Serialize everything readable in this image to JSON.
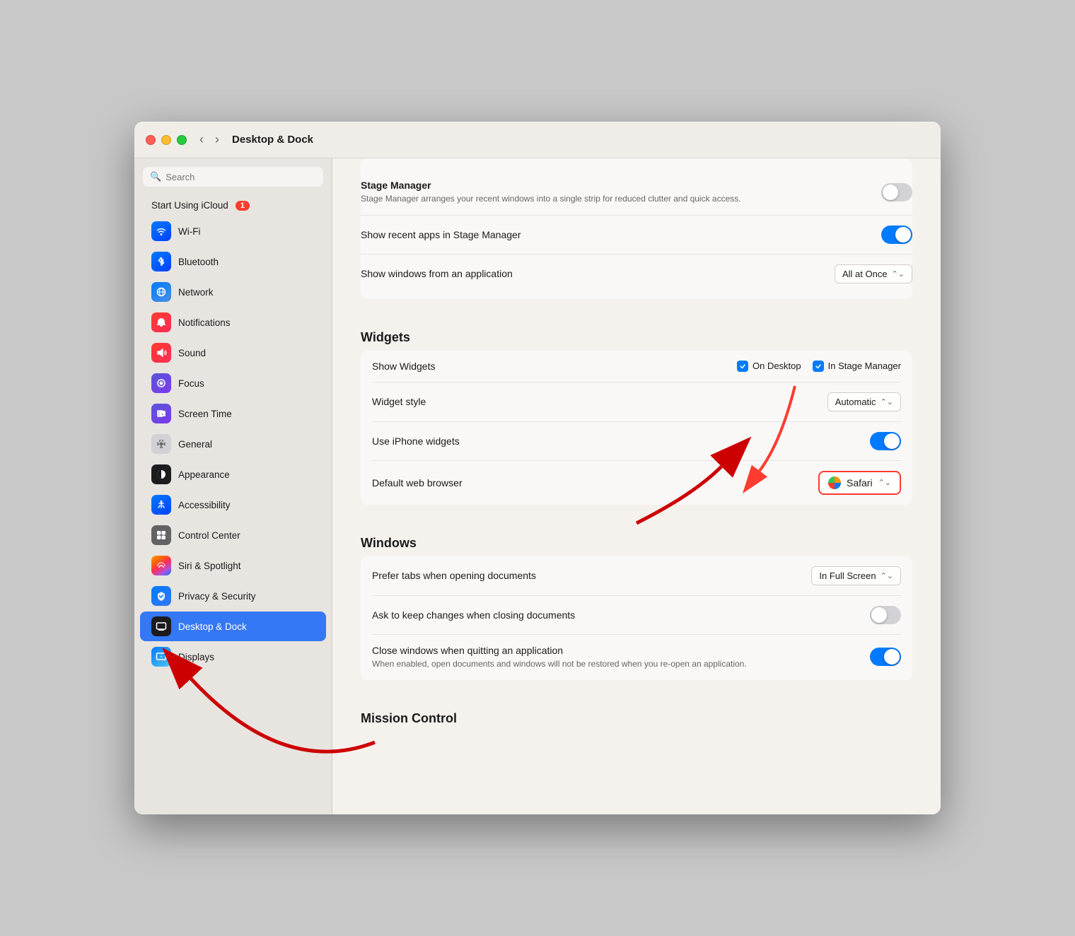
{
  "window": {
    "title": "Desktop & Dock"
  },
  "titlebar": {
    "back_label": "‹",
    "forward_label": "›",
    "title": "Desktop & Dock"
  },
  "sidebar": {
    "search_placeholder": "Search",
    "icloud_label": "Start Using iCloud",
    "icloud_badge": "1",
    "items": [
      {
        "id": "wifi",
        "label": "Wi-Fi",
        "icon_class": "ic-wifi",
        "icon_char": "📶"
      },
      {
        "id": "bluetooth",
        "label": "Bluetooth",
        "icon_class": "ic-bluetooth",
        "icon_char": "B"
      },
      {
        "id": "network",
        "label": "Network",
        "icon_class": "ic-network",
        "icon_char": "🌐"
      },
      {
        "id": "notifications",
        "label": "Notifications",
        "icon_class": "ic-notifications",
        "icon_char": "🔔"
      },
      {
        "id": "sound",
        "label": "Sound",
        "icon_class": "ic-sound",
        "icon_char": "🔊"
      },
      {
        "id": "focus",
        "label": "Focus",
        "icon_class": "ic-focus",
        "icon_char": "🌙"
      },
      {
        "id": "screentime",
        "label": "Screen Time",
        "icon_class": "ic-screentime",
        "icon_char": "⏳"
      },
      {
        "id": "general",
        "label": "General",
        "icon_class": "ic-general",
        "icon_char": "⚙"
      },
      {
        "id": "appearance",
        "label": "Appearance",
        "icon_class": "ic-appearance",
        "icon_char": "◑"
      },
      {
        "id": "accessibility",
        "label": "Accessibility",
        "icon_class": "ic-accessibility",
        "icon_char": "♿"
      },
      {
        "id": "controlcenter",
        "label": "Control Center",
        "icon_class": "ic-controlcenter",
        "icon_char": "⊞"
      },
      {
        "id": "siri",
        "label": "Siri & Spotlight",
        "icon_class": "ic-siri",
        "icon_char": "S"
      },
      {
        "id": "privacy",
        "label": "Privacy & Security",
        "icon_class": "ic-privacy",
        "icon_char": "🔒"
      },
      {
        "id": "desktop",
        "label": "Desktop & Dock",
        "icon_class": "ic-desktop",
        "icon_char": "🖥"
      },
      {
        "id": "displays",
        "label": "Displays",
        "icon_class": "ic-displays",
        "icon_char": "🖵"
      }
    ]
  },
  "main": {
    "stage_manager": {
      "title": "Stage Manager",
      "subtitle": "Stage Manager arranges your recent windows into a single strip for reduced clutter and quick access.",
      "show_recent_apps_label": "Show recent apps in Stage Manager",
      "show_recent_apps_value": true,
      "show_windows_label": "Show windows from an application",
      "show_windows_value": "All at Once"
    },
    "widgets": {
      "section_title": "Widgets",
      "show_widgets_label": "Show Widgets",
      "on_desktop_label": "On Desktop",
      "in_stage_manager_label": "In Stage Manager",
      "on_desktop_checked": true,
      "in_stage_manager_checked": true,
      "widget_style_label": "Widget style",
      "widget_style_value": "Automatic",
      "use_iphone_label": "Use iPhone widgets",
      "use_iphone_value": true,
      "default_browser_label": "Default web browser",
      "default_browser_value": "Safari"
    },
    "windows": {
      "section_title": "Windows",
      "prefer_tabs_label": "Prefer tabs when opening documents",
      "prefer_tabs_value": "In Full Screen",
      "ask_keep_label": "Ask to keep changes when closing documents",
      "ask_keep_value": false,
      "close_windows_label": "Close windows when quitting an application",
      "close_windows_sub": "When enabled, open documents and windows will not be restored when you re-open an application.",
      "close_windows_value": true
    },
    "mission_control": {
      "section_title": "Mission Control"
    }
  }
}
